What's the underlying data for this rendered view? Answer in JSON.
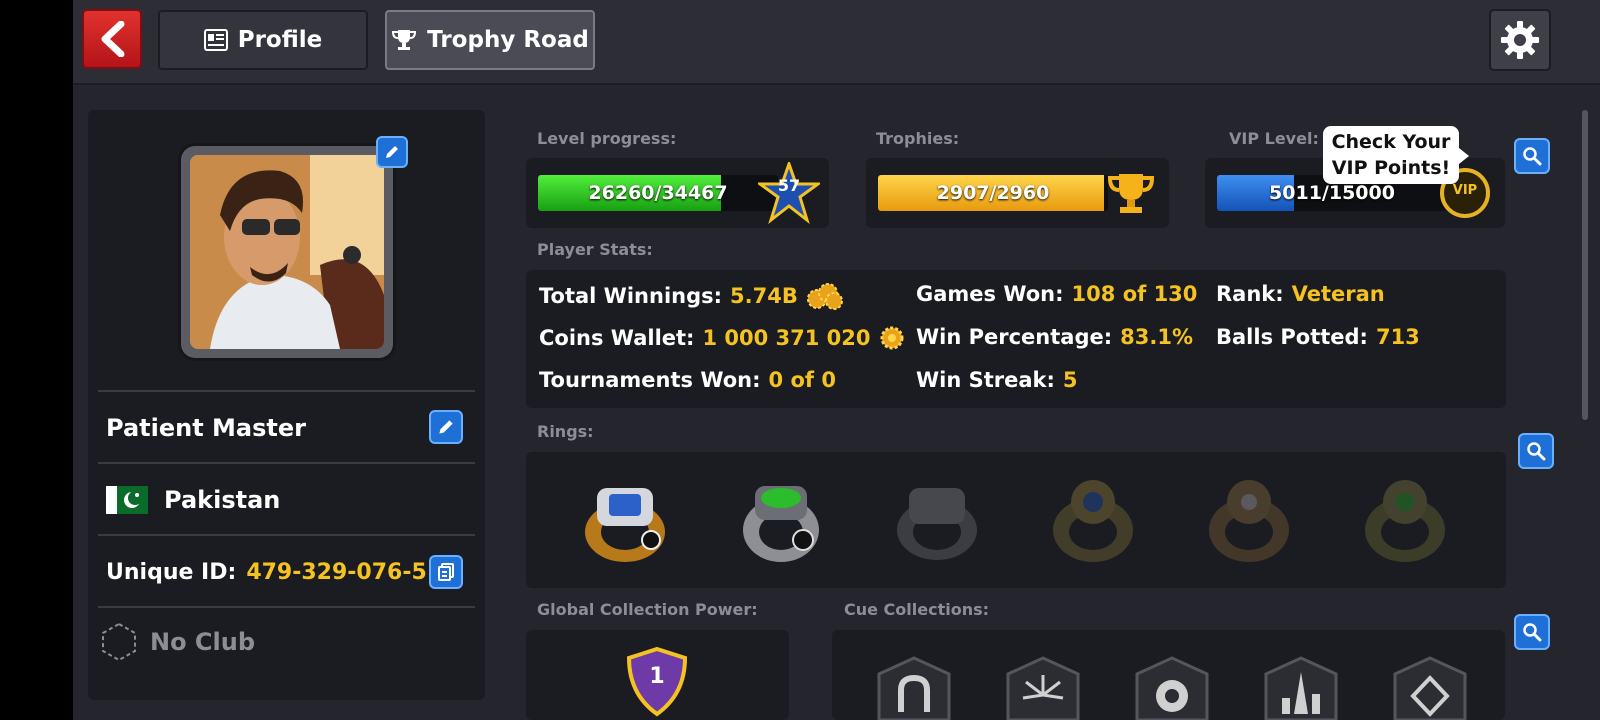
{
  "header": {
    "tabs": [
      {
        "label": "Profile",
        "icon": "id-card-icon",
        "active": false
      },
      {
        "label": "Trophy Road",
        "icon": "trophy-icon",
        "active": true
      }
    ]
  },
  "player": {
    "name": "Patient Master",
    "country": "Pakistan",
    "unique_id_label": "Unique ID:",
    "unique_id": "479-329-076-5",
    "club": "No Club"
  },
  "progress": {
    "level": {
      "label": "Level progress:",
      "text": "26260/34467",
      "current": 26260,
      "max": 34467,
      "badge": "57",
      "color": "#22c41a"
    },
    "trophies": {
      "label": "Trophies:",
      "text": "2907/2960",
      "current": 2907,
      "max": 2960,
      "color": "#f7b21e"
    },
    "vip": {
      "label": "VIP Level:",
      "text": "5011/15000",
      "current": 5011,
      "max": 15000,
      "color": "#1f73d9",
      "badge": "VIP",
      "tooltip_line1": "Check Your",
      "tooltip_line2": "VIP Points!"
    }
  },
  "stats": {
    "label": "Player Stats:",
    "total_winnings": {
      "label": "Total Winnings:",
      "value": "5.74B"
    },
    "coins_wallet": {
      "label": "Coins Wallet:",
      "value": "1 000 371 020"
    },
    "tournaments_won": {
      "label": "Tournaments Won:",
      "value": "0 of 0"
    },
    "games_won": {
      "label": "Games Won:",
      "value": "108 of 130"
    },
    "win_percentage": {
      "label": "Win Percentage:",
      "value": "83.1%"
    },
    "win_streak": {
      "label": "Win Streak:",
      "value": "5"
    },
    "rank": {
      "label": "Rank:",
      "value": "Veteran"
    },
    "balls_potted": {
      "label": "Balls Potted:",
      "value": "713"
    }
  },
  "rings": {
    "label": "Rings:",
    "items": [
      {
        "name": "lisbon-ring",
        "owned": true,
        "color": "#d99a22"
      },
      {
        "name": "sydney-ring",
        "owned": true,
        "color": "#2bbd2b"
      },
      {
        "name": "ring-3",
        "owned": false,
        "color": "#7a7b83"
      },
      {
        "name": "ring-4",
        "owned": false,
        "color": "#8a7a3a"
      },
      {
        "name": "ring-5",
        "owned": false,
        "color": "#8a6a3a"
      },
      {
        "name": "ring-6",
        "owned": false,
        "color": "#7a7a3a"
      }
    ]
  },
  "collections": {
    "global_power_label": "Global Collection Power:",
    "global_power_level": "1",
    "cue_label": "Cue Collections:",
    "cues": [
      "horseshoe-icon",
      "fireworks-icon",
      "eight-ball-icon",
      "paris-icon",
      "diamond-icon"
    ]
  },
  "colors": {
    "gold_text": "#f5c321",
    "panel": "#1b1c21",
    "background": "#25262d",
    "accent_blue": "#1e6fd6"
  }
}
